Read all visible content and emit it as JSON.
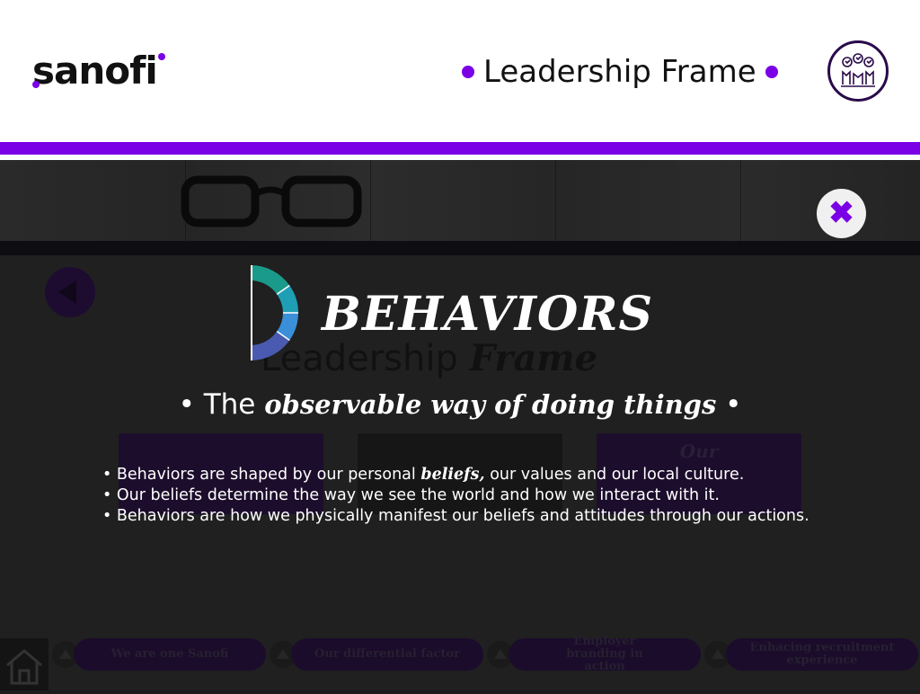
{
  "header": {
    "logo_text": "sanofi",
    "title": "Leadership Frame",
    "icon": "people-voting-icon"
  },
  "background": {
    "leadership_text": "Leadership",
    "leadership_frame": "Frame",
    "card_text": "Our",
    "nav": [
      {
        "label": "We are one Sanofi"
      },
      {
        "label": "Our differential factor"
      },
      {
        "label": "Employer branding in action"
      },
      {
        "label": "Enhacing recruitment experience"
      }
    ]
  },
  "overlay": {
    "close_icon": "close-x-icon",
    "title": "BEHAVIORS",
    "subtitle_pre": "• The ",
    "subtitle_emph": "observable way of doing things",
    "subtitle_post": " •",
    "bullet1_pre": "• Behaviors are shaped by our personal ",
    "bullet1_emph": "beliefs,",
    "bullet1_post": " our values and our local culture.",
    "bullet2": "• Our beliefs determine the way we see the world and how we interact with it.",
    "bullet3": "• Behaviors are how we physically manifest our beliefs and attitudes through our actions."
  },
  "colors": {
    "accent": "#7a00e6",
    "emblem": [
      "#1a9a8a",
      "#1f9fb5",
      "#3a8fd8",
      "#4a5ab0"
    ]
  }
}
